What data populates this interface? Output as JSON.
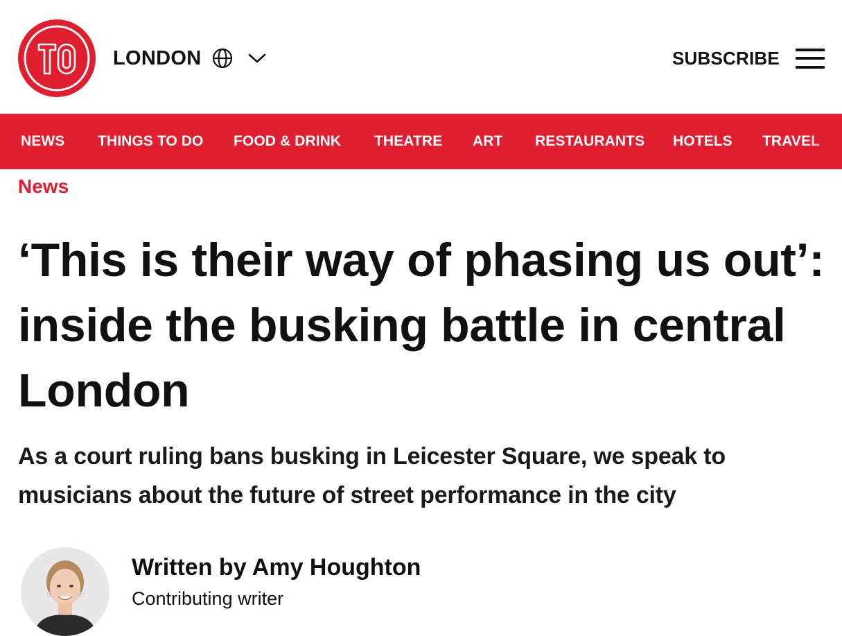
{
  "brand": {
    "logo_text": "TO",
    "city": "LONDON",
    "accent_color": "#e01e2f"
  },
  "header": {
    "subscribe_label": "SUBSCRIBE"
  },
  "icons": {
    "globe": "globe-icon",
    "chevron": "chevron-down-icon",
    "menu": "hamburger-menu-icon"
  },
  "nav": {
    "items": [
      {
        "label": "NEWS"
      },
      {
        "label": "THINGS TO DO"
      },
      {
        "label": "FOOD & DRINK"
      },
      {
        "label": "THEATRE"
      },
      {
        "label": "ART"
      },
      {
        "label": "RESTAURANTS"
      },
      {
        "label": "HOTELS"
      },
      {
        "label": "TRAVEL"
      }
    ]
  },
  "article": {
    "section": "News",
    "headline": "‘This is their way of phasing us out’: inside the busking battle in central London",
    "standfirst": "As a court ruling bans busking in Leicester Square, we speak to musicians about the future of street performance in the city",
    "author": {
      "name": "Written by Amy Houghton",
      "role": "Contributing writer"
    }
  }
}
